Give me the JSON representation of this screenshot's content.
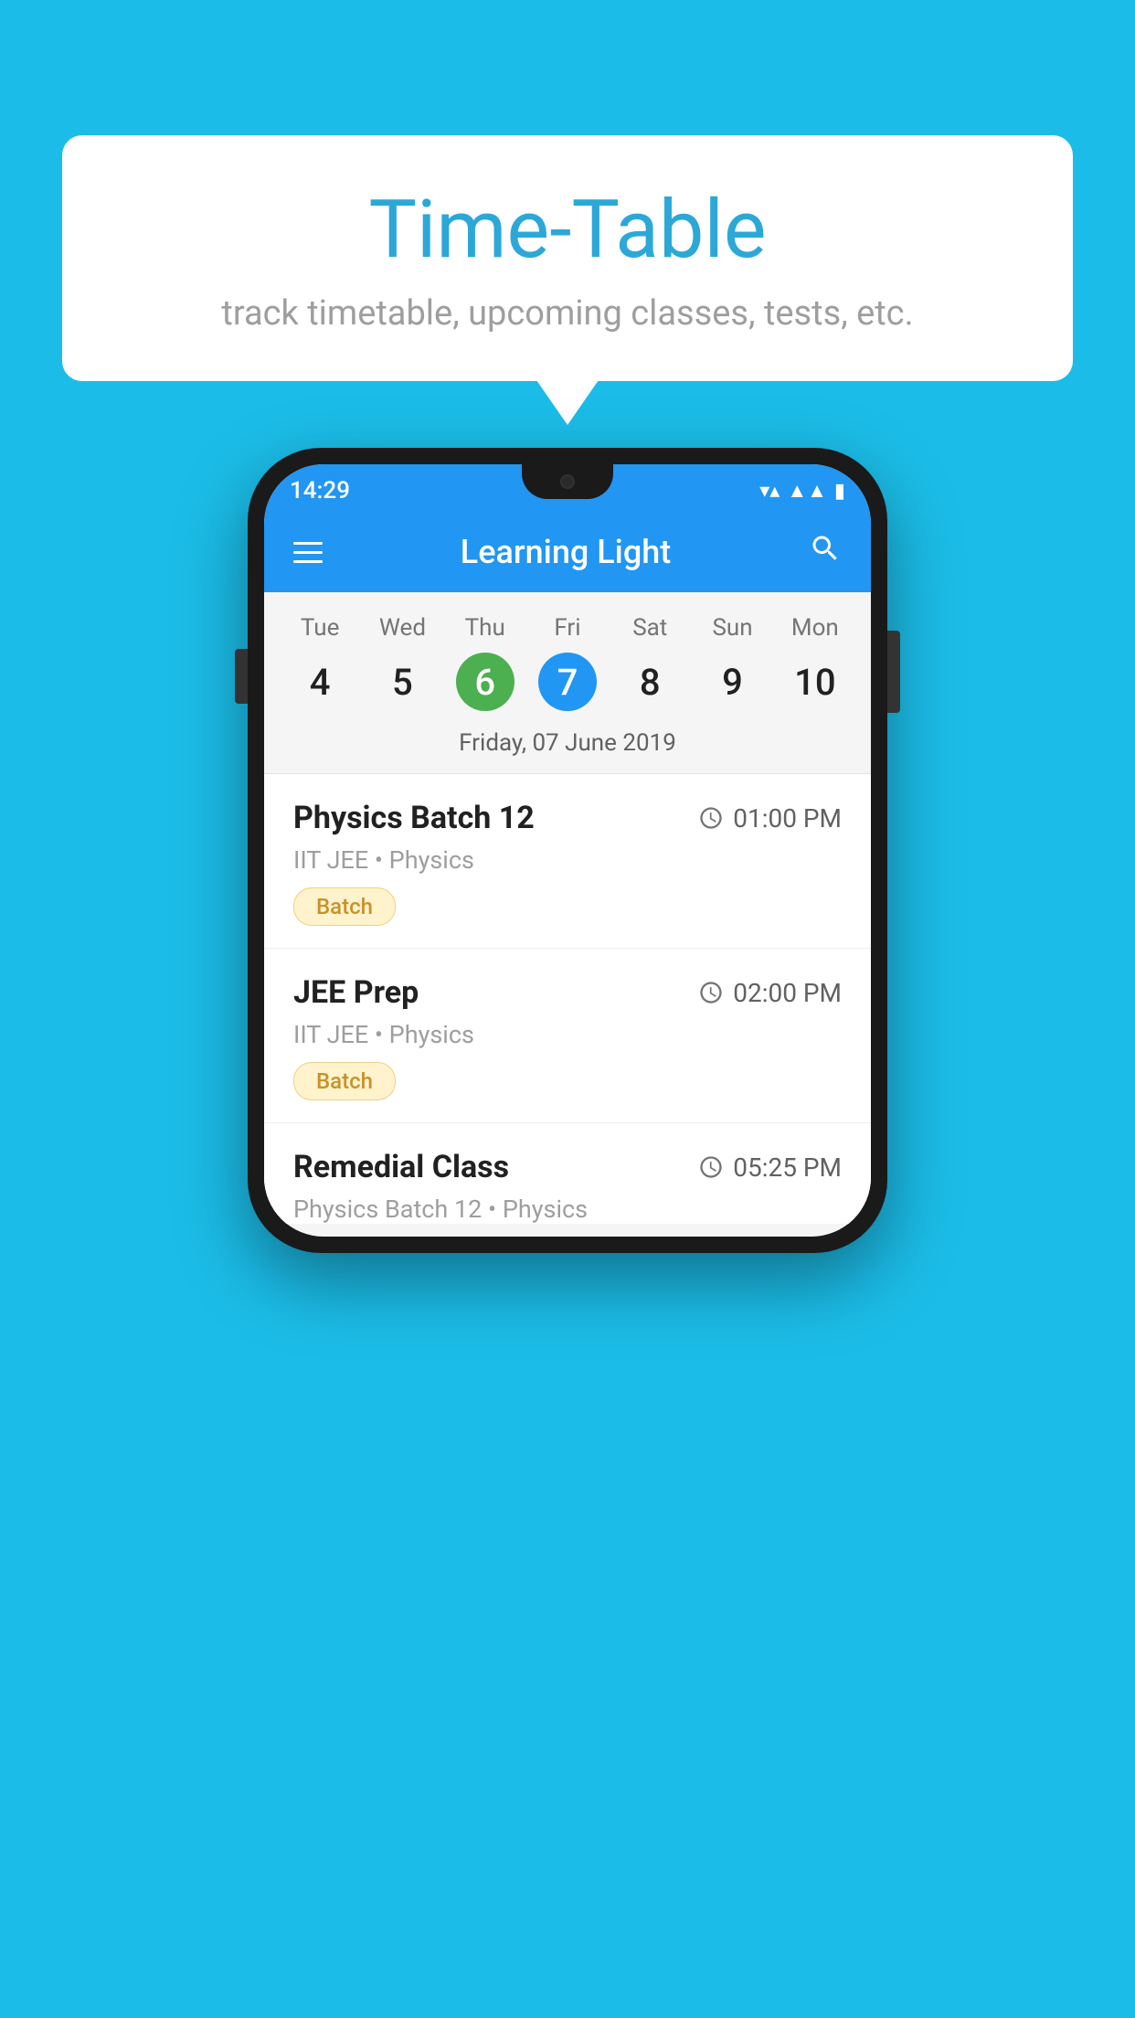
{
  "background_color": "#1BBDE8",
  "speech_bubble": {
    "title": "Time-Table",
    "subtitle": "track timetable, upcoming classes, tests, etc."
  },
  "phone": {
    "status_bar": {
      "time": "14:29"
    },
    "app_bar": {
      "title": "Learning Light"
    },
    "calendar": {
      "days": [
        {
          "name": "Tue",
          "num": "4",
          "state": "normal"
        },
        {
          "name": "Wed",
          "num": "5",
          "state": "normal"
        },
        {
          "name": "Thu",
          "num": "6",
          "state": "today"
        },
        {
          "name": "Fri",
          "num": "7",
          "state": "selected"
        },
        {
          "name": "Sat",
          "num": "8",
          "state": "normal"
        },
        {
          "name": "Sun",
          "num": "9",
          "state": "normal"
        },
        {
          "name": "Mon",
          "num": "10",
          "state": "normal"
        }
      ],
      "selected_date_label": "Friday, 07 June 2019"
    },
    "schedule": [
      {
        "title": "Physics Batch 12",
        "time": "01:00 PM",
        "subtitle": "IIT JEE • Physics",
        "badge": "Batch"
      },
      {
        "title": "JEE Prep",
        "time": "02:00 PM",
        "subtitle": "IIT JEE • Physics",
        "badge": "Batch"
      },
      {
        "title": "Remedial Class",
        "time": "05:25 PM",
        "subtitle": "Physics Batch 12 • Physics",
        "badge": null
      }
    ]
  }
}
